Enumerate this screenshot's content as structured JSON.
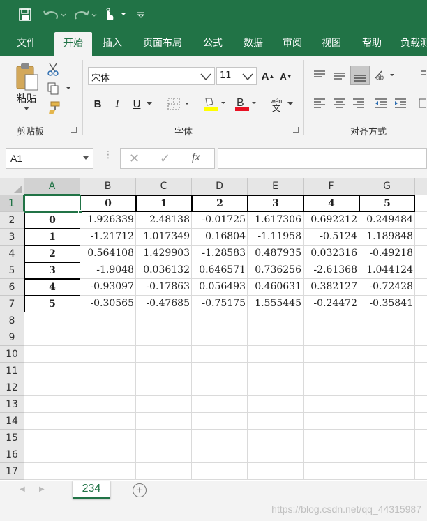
{
  "quick_access": {
    "save": "save-icon",
    "undo": "undo-icon",
    "redo": "redo-icon",
    "touch": "touch-mode-icon",
    "customize": "customize-qat-icon"
  },
  "tabs": [
    "文件",
    "开始",
    "插入",
    "页面布局",
    "公式",
    "数据",
    "审阅",
    "视图",
    "帮助",
    "负载测"
  ],
  "active_tab": "开始",
  "ribbon": {
    "clipboard": {
      "paste_label": "粘贴",
      "group_label": "剪贴板"
    },
    "font": {
      "font_name": "宋体",
      "font_size": "11",
      "bold": "B",
      "italic": "I",
      "underline": "U",
      "grow": "A",
      "shrink": "A",
      "wen_top": "wén",
      "wen_bottom": "文",
      "group_label": "字体",
      "highlight_color": "#ffff00",
      "font_color": "#e81123"
    },
    "alignment": {
      "group_label": "对齐方式"
    }
  },
  "formula_bar": {
    "name_box": "A1",
    "cancel": "✕",
    "enter": "✓",
    "fx": "fx",
    "formula": ""
  },
  "sheet": {
    "columns": [
      "A",
      "B",
      "C",
      "D",
      "E",
      "F",
      "G"
    ],
    "selected_column": "A",
    "rows": [
      "1",
      "2",
      "3",
      "4",
      "5",
      "6",
      "7",
      "8",
      "9",
      "10",
      "11",
      "12",
      "13",
      "14",
      "15",
      "16",
      "17"
    ],
    "selected_row": "1",
    "header_row": [
      "",
      "0",
      "1",
      "2",
      "3",
      "4",
      "5"
    ],
    "data": [
      [
        "0",
        "1.926339",
        "2.48138",
        "-0.01725",
        "1.617306",
        "0.692212",
        "0.249484"
      ],
      [
        "1",
        "-1.21712",
        "1.017349",
        "0.16804",
        "-1.11958",
        "-0.5124",
        "1.189848"
      ],
      [
        "2",
        "0.564108",
        "1.429903",
        "-1.28583",
        "0.487935",
        "0.032316",
        "-0.49218"
      ],
      [
        "3",
        "-1.9048",
        "0.036132",
        "0.646571",
        "0.736256",
        "-2.61368",
        "1.044124"
      ],
      [
        "4",
        "-0.93097",
        "-0.17863",
        "0.056493",
        "0.460631",
        "0.382127",
        "-0.72428"
      ],
      [
        "5",
        "-0.30565",
        "-0.47685",
        "-0.75175",
        "1.555445",
        "-0.24472",
        "-0.35841"
      ]
    ]
  },
  "sheet_tabs": {
    "active": "234",
    "add": "+"
  },
  "watermark": "https://blog.csdn.net/qq_44315987"
}
